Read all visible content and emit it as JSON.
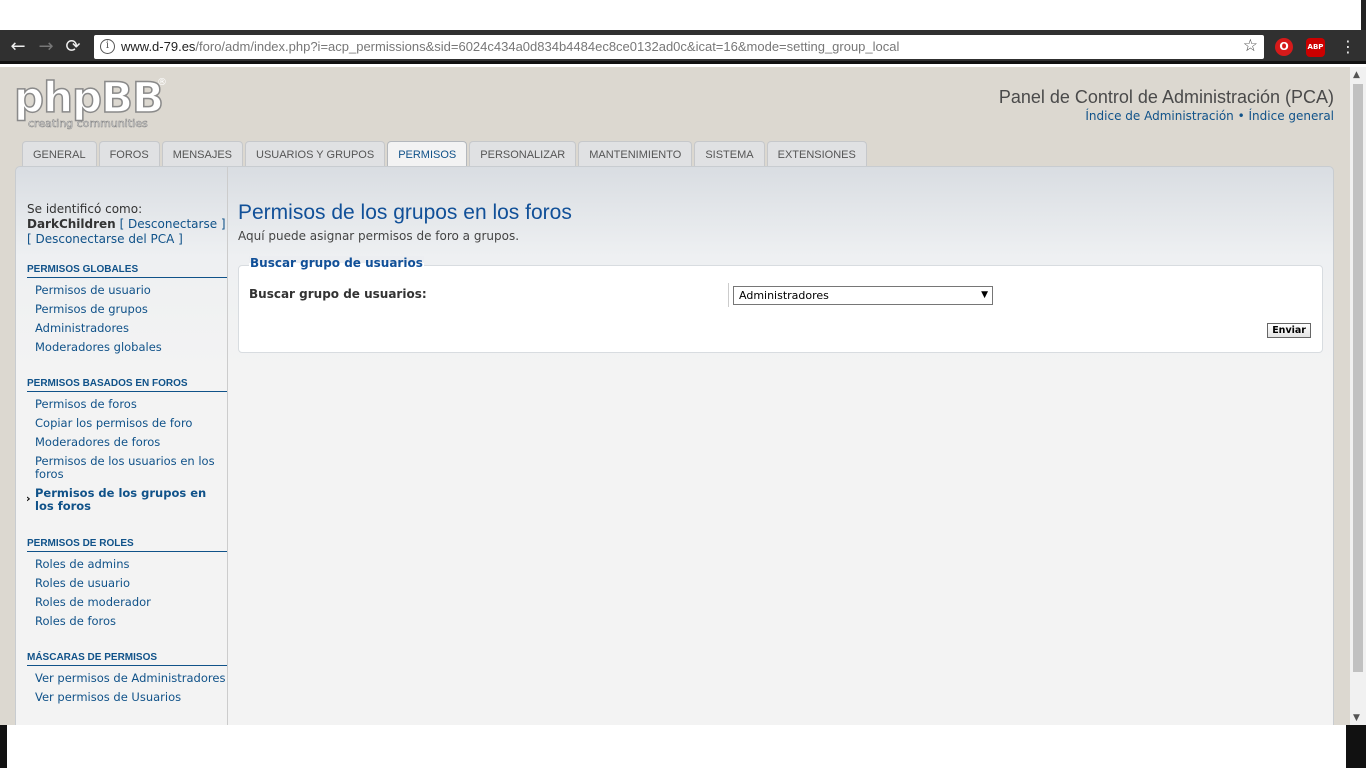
{
  "browser": {
    "url_host": "www.d-79.es",
    "url_path": "/foro/adm/index.php?i=acp_permissions&sid=6024c434a0d834b4484ec8ce0132ad0c&icat=16&mode=setting_group_local",
    "back_glyph": "←",
    "forward_glyph": "→",
    "reload_glyph": "⟳",
    "info_glyph": "i",
    "star_glyph": "☆",
    "menu_glyph": "⋮",
    "ext1_label": "O",
    "ext2_label": "ABP"
  },
  "logo": {
    "text": "phpBB",
    "registered": "®",
    "tagline": "creating     communities"
  },
  "header": {
    "title": "Panel de Control de Administración (PCA)",
    "link_admin": "Índice de Administración",
    "separator": " • ",
    "link_general": "Índice general"
  },
  "tabs": [
    {
      "label": "General"
    },
    {
      "label": "Foros"
    },
    {
      "label": "Mensajes"
    },
    {
      "label": "Usuarios y grupos"
    },
    {
      "label": "Permisos"
    },
    {
      "label": "Personalizar"
    },
    {
      "label": "Mantenimiento"
    },
    {
      "label": "Sistema"
    },
    {
      "label": "Extensiones"
    }
  ],
  "login": {
    "prefix": "Se identificó como:",
    "username": "DarkChildren",
    "logout": "[ Desconectarse ]",
    "logout_acp": "[ Desconectarse del PCA ]"
  },
  "sidebar": {
    "sections": [
      {
        "title": "Permisos globales",
        "items": [
          "Permisos de usuario",
          "Permisos de grupos",
          "Administradores",
          "Moderadores globales"
        ]
      },
      {
        "title": "Permisos basados en foros",
        "items": [
          "Permisos de foros",
          "Copiar los permisos de foro",
          "Moderadores de foros",
          "Permisos de los usuarios en los foros",
          "Permisos de los grupos en los foros"
        ]
      },
      {
        "title": "Permisos de roles",
        "items": [
          "Roles de admins",
          "Roles de usuario",
          "Roles de moderador",
          "Roles de foros"
        ]
      },
      {
        "title": "Máscaras de permisos",
        "items": [
          "Ver permisos de Administradores",
          "Ver permisos de Usuarios"
        ]
      }
    ]
  },
  "main": {
    "title": "Permisos de los grupos en los foros",
    "description": "Aquí puede asignar permisos de foro a grupos.",
    "fieldset_legend": "Buscar grupo de usuarios",
    "field_label": "Buscar grupo de usuarios:",
    "select_value": "Administradores",
    "submit_label": "Enviar"
  },
  "colors": {
    "link": "#105289",
    "title": "#115098",
    "page_bg": "#dcd8d0"
  }
}
